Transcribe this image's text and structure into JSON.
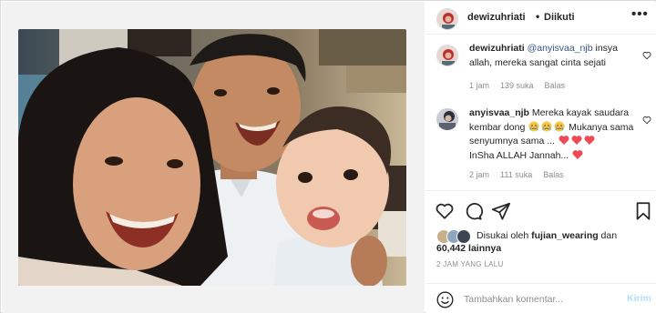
{
  "post": {
    "author": "dewizuhriati",
    "separator": "•",
    "follow_status": "Diikuti",
    "more_label": "•••"
  },
  "comments": [
    {
      "username": "dewizuhriati",
      "mention": "@anyisvaa_njb",
      "text_after_mention": " insya allah, mereka sangat cinta sejati",
      "time": "1 jam",
      "likes": "139 suka",
      "reply_label": "Balas"
    },
    {
      "username": "anyisvaa_njb",
      "text_1": " Mereka kayak saudara kembar dong",
      "text_2": " Mukanya sama senyumnya sama ...",
      "text_3": "InSha ALLAH Jannah...",
      "time": "2 jam",
      "likes": "111 suka",
      "reply_label": "Balas"
    }
  ],
  "likes": {
    "prefix": "Disukai oleh ",
    "first_user": "fujian_wearing",
    "connector": " dan",
    "count": "60,442 lainnya"
  },
  "timestamp": "2 JAM YANG LALU",
  "composer": {
    "placeholder": "Tambahkan komentar...",
    "send_label": "Kirim"
  },
  "icons": {
    "heart": "heart-icon",
    "comment": "comment-icon",
    "share": "share-icon",
    "save": "bookmark-icon",
    "emoji": "smile-icon"
  },
  "colors": {
    "mention": "#385185",
    "meta": "#8e8e8e",
    "send_disabled": "#b2dffc",
    "heart_emoji": "#ed4956"
  }
}
